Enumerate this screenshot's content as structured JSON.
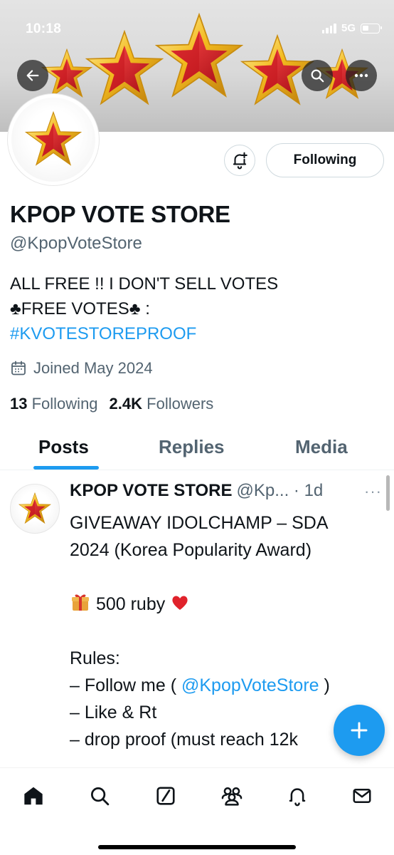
{
  "status_bar": {
    "time": "10:18",
    "network": "5G"
  },
  "banner": {
    "back_icon": "arrow-left-icon",
    "search_icon": "search-icon",
    "more_icon": "more-horizontal-icon"
  },
  "profile": {
    "display_name": "KPOP VOTE STORE",
    "handle": "@KpopVoteStore",
    "bio_line1": "ALL FREE !! I DON'T SELL VOTES",
    "bio_line2": "♣FREE VOTES♣ :",
    "bio_hashtag": "#KVOTESTOREPROOF",
    "joined": "Joined May 2024",
    "following_count": "13",
    "following_label": "Following",
    "followers_count": "2.4K",
    "followers_label": "Followers"
  },
  "actions": {
    "notify_icon": "bell-plus-icon",
    "following_button": "Following"
  },
  "tabs": [
    {
      "label": "Posts",
      "active": true
    },
    {
      "label": "Replies",
      "active": false
    },
    {
      "label": "Media",
      "active": false
    }
  ],
  "tweet": {
    "author": "KPOP VOTE STORE",
    "handle_time": "@Kp... · 1d",
    "more": "···",
    "line1": "GIVEAWAY IDOLCHAMP – SDA",
    "line2": "2024 (Korea Popularity Award)",
    "line3": "500 ruby",
    "line4": "Rules:",
    "line5_pre": "– Follow me  ( ",
    "line5_mention": "@KpopVoteStore",
    "line5_post": " )",
    "line6": "– Like & Rt",
    "line7": "– drop proof (must reach 12k"
  },
  "fab": {
    "icon": "plus-icon"
  },
  "bottom_nav": [
    {
      "icon": "home-icon",
      "active": true
    },
    {
      "icon": "search-icon",
      "active": false
    },
    {
      "icon": "grok-icon",
      "active": false
    },
    {
      "icon": "communities-icon",
      "active": false
    },
    {
      "icon": "bell-icon",
      "active": false
    },
    {
      "icon": "mail-icon",
      "active": false
    }
  ],
  "colors": {
    "accent": "#1d9bf0",
    "text_primary": "#0f1419",
    "text_secondary": "#536471",
    "star_red": "#d21f26",
    "star_gold": "#f2b51c"
  }
}
